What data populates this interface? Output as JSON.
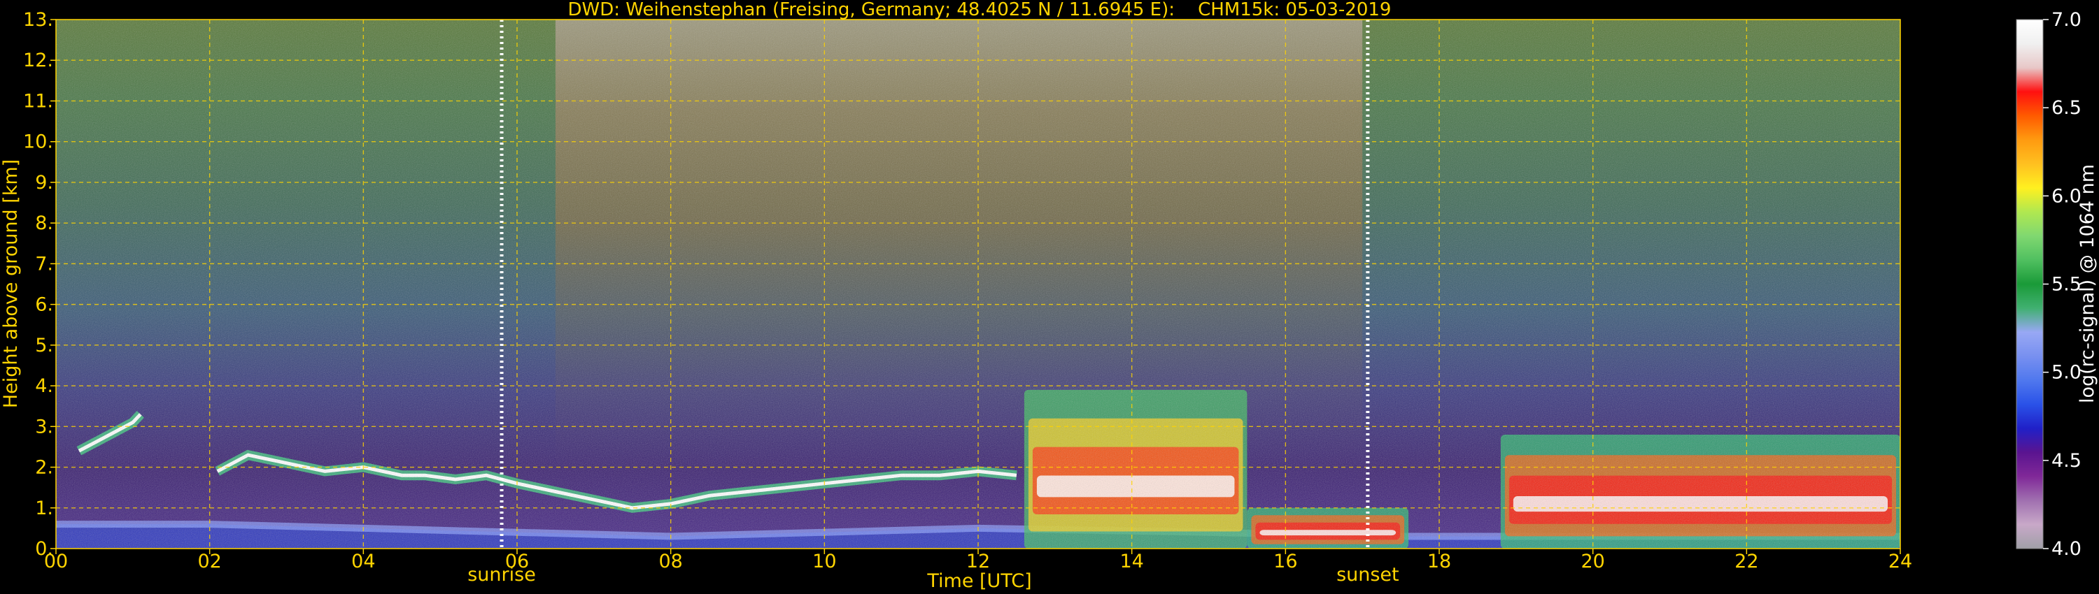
{
  "chart_data": {
    "type": "heatmap",
    "title": "DWD: Weihenstephan (Freising, Germany; 48.4025 N / 11.6945 E):    CHM15k: 05-03-2019",
    "xlabel": "Time [UTC]",
    "ylabel": "Height above ground [km]",
    "colorbar_label": "log(rc-signal) @ 1064 nm",
    "xlim": [
      0,
      24
    ],
    "ylim": [
      0,
      13
    ],
    "x_ticks": [
      0,
      2,
      4,
      6,
      8,
      10,
      12,
      14,
      16,
      18,
      20,
      22,
      24
    ],
    "x_tick_labels": [
      "00",
      "02",
      "04",
      "06",
      "08",
      "10",
      "12",
      "14",
      "16",
      "18",
      "20",
      "22",
      "24"
    ],
    "y_ticks": [
      0,
      1,
      2,
      3,
      4,
      5,
      6,
      7,
      8,
      9,
      10,
      11,
      12,
      13
    ],
    "y_tick_labels": [
      "0.",
      "1.",
      "2.",
      "3.",
      "4.",
      "5.",
      "6.",
      "7.",
      "8.",
      "9.",
      "10.",
      "11.",
      "12.",
      "13."
    ],
    "grid": true,
    "colorbar": {
      "range": [
        4.0,
        7.0
      ],
      "ticks": [
        4.0,
        4.5,
        5.0,
        5.5,
        6.0,
        6.5,
        7.0
      ],
      "tick_labels": [
        "4.0",
        "4.5",
        "5.0",
        "5.5",
        "6.0",
        "6.5",
        "7.0"
      ],
      "colors": [
        "#a0a0a8",
        "#c8a8c8",
        "#a070b0",
        "#802898",
        "#5a1490",
        "#2020c8",
        "#2a52e8",
        "#5078ee",
        "#7890f0",
        "#98a8f4",
        "#40b070",
        "#1a9a38",
        "#50c060",
        "#80d870",
        "#b0e850",
        "#fff020",
        "#ffc020",
        "#ff9a10",
        "#ff5a00",
        "#ff1010",
        "#e8c8c8",
        "#f0f0f0",
        "#ffffff"
      ]
    },
    "markers": [
      {
        "label": "sunrise",
        "x": 5.8
      },
      {
        "label": "sunset",
        "x": 17.07
      }
    ],
    "features": [
      {
        "kind": "cloud_base",
        "points": [
          [
            0.3,
            2.4
          ],
          [
            0.6,
            2.7
          ],
          [
            1.0,
            3.1
          ],
          [
            1.1,
            3.3
          ]
        ]
      },
      {
        "kind": "cloud_base",
        "points": [
          [
            2.1,
            1.9
          ],
          [
            2.5,
            2.3
          ],
          [
            3.0,
            2.1
          ],
          [
            3.5,
            1.9
          ],
          [
            4.0,
            2.0
          ],
          [
            4.5,
            1.8
          ],
          [
            4.8,
            1.8
          ],
          [
            5.2,
            1.7
          ],
          [
            5.6,
            1.8
          ],
          [
            6.0,
            1.6
          ],
          [
            6.5,
            1.4
          ],
          [
            7.0,
            1.2
          ],
          [
            7.5,
            1.0
          ],
          [
            8.0,
            1.1
          ],
          [
            8.5,
            1.3
          ],
          [
            9.0,
            1.4
          ],
          [
            9.5,
            1.5
          ],
          [
            10.0,
            1.6
          ],
          [
            10.5,
            1.7
          ],
          [
            11.0,
            1.8
          ],
          [
            11.5,
            1.8
          ],
          [
            12.0,
            1.9
          ],
          [
            12.5,
            1.8
          ]
        ]
      },
      {
        "kind": "aerosol_layer",
        "points": [
          [
            0,
            0.6
          ],
          [
            2,
            0.6
          ],
          [
            4,
            0.5
          ],
          [
            6,
            0.4
          ],
          [
            8,
            0.3
          ],
          [
            10,
            0.4
          ],
          [
            12,
            0.5
          ],
          [
            15,
            0.4
          ],
          [
            17,
            0.3
          ],
          [
            20,
            0.3
          ],
          [
            24,
            0.3
          ]
        ]
      },
      {
        "kind": "convective_cloud",
        "x_range": [
          12.6,
          15.5
        ],
        "top_km": 3.9
      },
      {
        "kind": "low_stratus",
        "x_range": [
          15.5,
          17.6
        ],
        "top_km": 1.0
      },
      {
        "kind": "cumulus",
        "x_range": [
          18.8,
          24.0
        ],
        "top_km": 2.8
      }
    ]
  }
}
